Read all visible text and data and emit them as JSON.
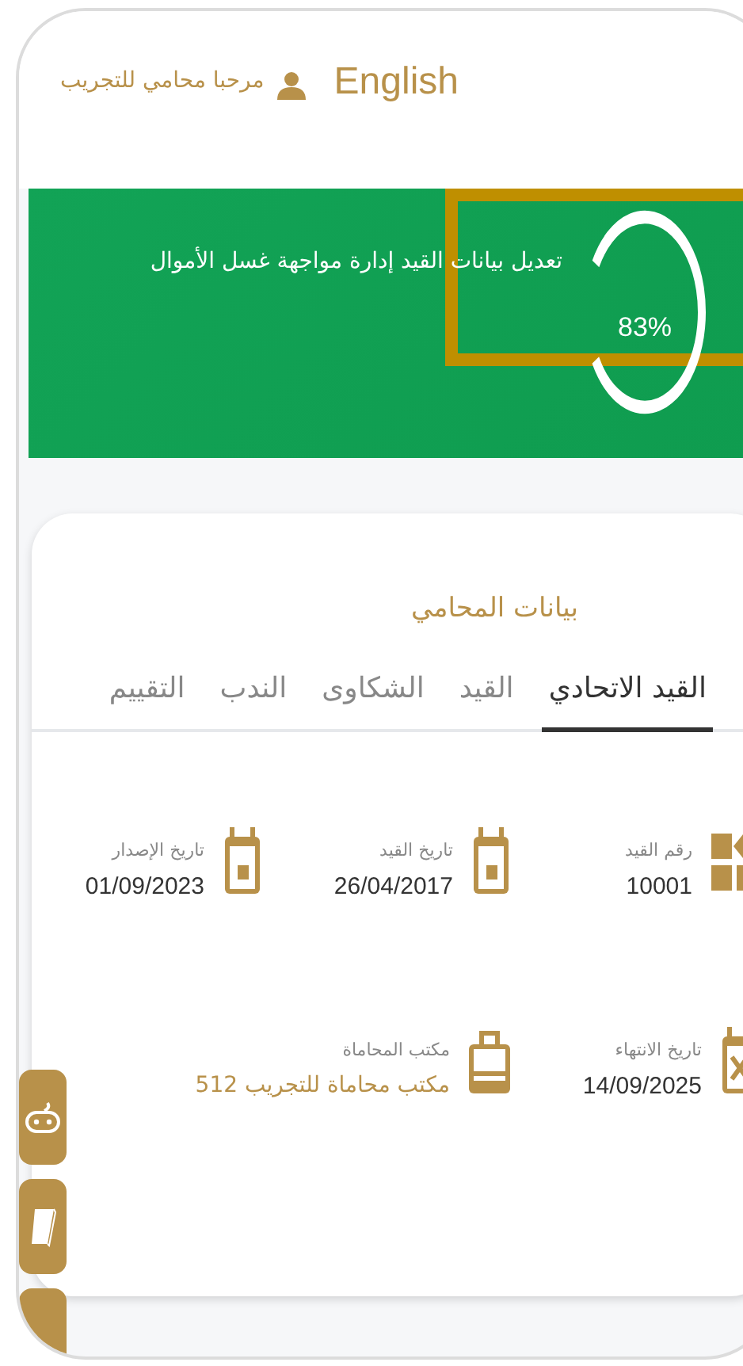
{
  "header": {
    "language_link": "English",
    "greeting": "مرحبا  محامي للتجريب"
  },
  "banner": {
    "title": "تعديل بيانات القيد إدارة مواجهة غسل الأموال",
    "percent": "83%",
    "level": 0.83
  },
  "section_title": "بيانات المحامي",
  "tabs": [
    {
      "label": "القيد الاتحادي",
      "selected": true
    },
    {
      "label": "القيد",
      "selected": false
    },
    {
      "label": "الشكاوى",
      "selected": false
    },
    {
      "label": "الندب",
      "selected": false
    },
    {
      "label": "التقييم",
      "selected": false
    }
  ],
  "fields": [
    {
      "kind": "number",
      "label": "رقم القيد",
      "value": "10001"
    },
    {
      "kind": "date",
      "label": "تاريخ القيد",
      "value": "26/04/2017"
    },
    {
      "kind": "date",
      "label": "تاريخ الإصدار",
      "value": "01/09/2023"
    },
    {
      "kind": "expiry",
      "label": "تاريخ الانتهاء",
      "value": "14/09/2025"
    },
    {
      "kind": "office",
      "label": "مكتب المحاماة",
      "value": "مكتب محاماة للتجريب 512"
    }
  ]
}
